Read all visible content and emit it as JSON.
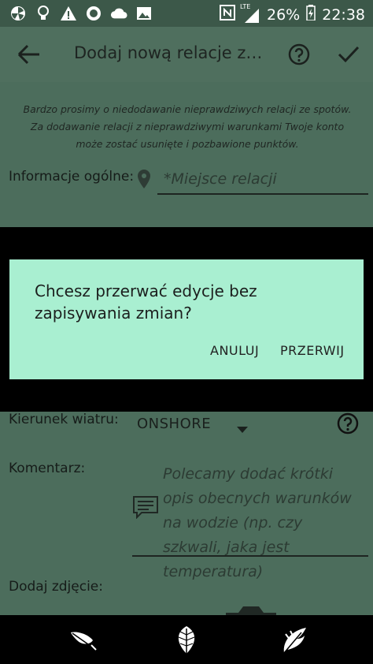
{
  "status_bar": {
    "icons_left": [
      "pinwheel-icon",
      "lightbulb-icon",
      "warning-icon",
      "circle-record-icon",
      "cloud-icon",
      "image-icon"
    ],
    "icons_right": [
      "nfc-icon",
      "lte-signal-icon",
      "battery-charging-icon"
    ],
    "network": "LTE",
    "battery": "26%",
    "time": "22:38"
  },
  "toolbar": {
    "title": "Dodaj nową relacje ze s..."
  },
  "form": {
    "notice": "Bardzo prosimy o niedodawanie nieprawdziwych relacji ze spotów. Za dodawanie relacji z nieprawdziwymi warunkami Twoje konto może zostać usunięte i pozbawione punktów.",
    "general_label": "Informacje ogólne:",
    "location_placeholder": "*Miejsce relacji",
    "wind_direction_label": "Kierunek wiatru:",
    "wind_direction_value": "ONSHORE",
    "comment_label": "Komentarz:",
    "comment_placeholder": "Polecamy dodać krótki opis obecnych warunków na wodzie (np. czy szkwali, jaka jest temperatura)",
    "photo_label": "Dodaj zdjęcie:"
  },
  "dialog": {
    "message": "Chcesz przerwać edycje bez zapisywania zmian?",
    "cancel_label": "ANULUJ",
    "abort_label": "PRZERWIJ"
  },
  "bottom_nav": {
    "items": [
      "leaf-icon",
      "leaf-round-icon",
      "leaf-fern-icon"
    ]
  },
  "colors": {
    "dialog_bg": "#a9efd1",
    "scrim_content": "#4c6d5c",
    "status_bar": "#3c5849"
  }
}
